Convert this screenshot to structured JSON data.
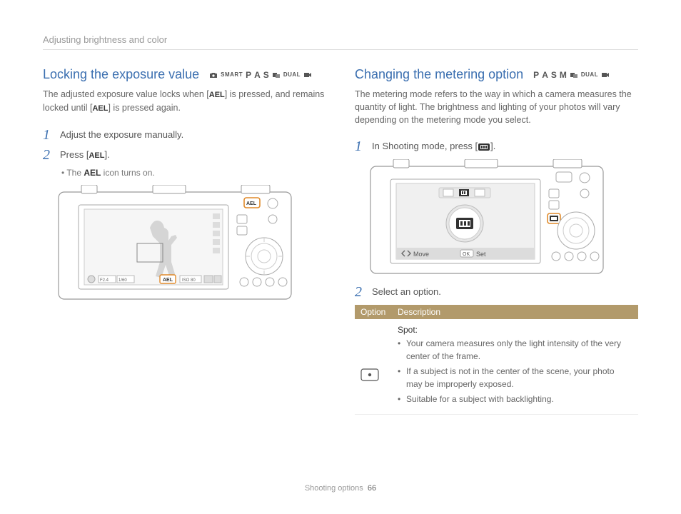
{
  "header": "Adjusting brightness and color",
  "left": {
    "title": "Locking the exposure value",
    "modes": {
      "smart": "SMART",
      "p": "P",
      "a": "A",
      "s": "S",
      "dual": "DUAL"
    },
    "intro_a": "The adjusted exposure value locks when [",
    "intro_ael": "AEL",
    "intro_b": "] is pressed, and remains locked until [",
    "intro_c": "] is pressed again.",
    "step1": "Adjust the exposure manually.",
    "step2_a": "Press [",
    "step2_ael": "AEL",
    "step2_b": "].",
    "sub_a": "The ",
    "sub_ael": "AEL",
    "sub_b": " icon turns on.",
    "lcd": {
      "f": "F2.4",
      "shutter": "1/60",
      "ael": "AEL",
      "iso": "ISO 80"
    }
  },
  "right": {
    "title": "Changing the metering option",
    "modes": {
      "p": "P",
      "a": "A",
      "s": "S",
      "m": "M",
      "dual": "DUAL"
    },
    "intro": "The metering mode refers to the way in which a camera measures the quantity of light. The brightness and lighting of your photos will vary depending on the metering mode you select.",
    "step1_a": "In Shooting mode, press [",
    "step1_b": "].",
    "step2": "Select an option.",
    "lcd": {
      "move": "Move",
      "set": "Set",
      "ok": "OK"
    },
    "table": {
      "hdr_option": "Option",
      "hdr_desc": "Description",
      "spot_title": "Spot:",
      "d1": "Your camera measures only the light intensity of the very center of the frame.",
      "d2": "If a subject is not in the center of the scene, your photo may be improperly exposed.",
      "d3": "Suitable for a subject with backlighting."
    }
  },
  "footer": {
    "section": "Shooting options",
    "page": "66"
  }
}
